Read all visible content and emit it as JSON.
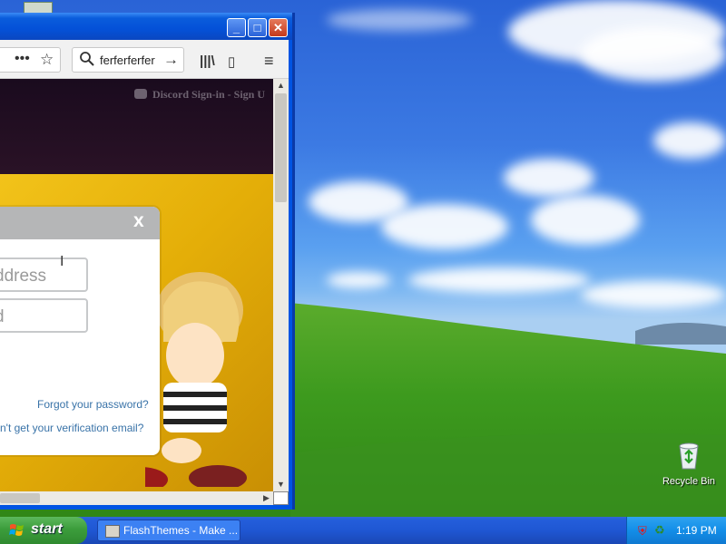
{
  "browser": {
    "titlebar": {
      "minimize_label": "_",
      "maximize_label": "□",
      "close_label": "✕"
    },
    "toolbar": {
      "more_label": "•••",
      "bookmark_icon": "☆",
      "search_value": "ferferferfer",
      "go_icon": "→",
      "library_icon": "|||\\",
      "sidebar_icon": "▯",
      "menu_icon": "≡"
    },
    "content": {
      "tab_hint": "Discord Sign-in - Sign U"
    },
    "modal": {
      "close_label": "x",
      "email_placeholder": "ddress",
      "password_placeholder": "d",
      "forgot_password": "Forgot your password?",
      "verification_email": "n't get your verification email?"
    }
  },
  "desktop": {
    "recycle_bin_label": "Recycle Bin"
  },
  "taskbar": {
    "start_label": "start",
    "task_label": "FlashThemes - Make ...",
    "clock": "1:19 PM"
  },
  "colors": {
    "xp_blue": "#0054e3",
    "start_green": "#3c9d3c",
    "link_blue": "#3973a8",
    "content_yellow": "#e6b810"
  }
}
